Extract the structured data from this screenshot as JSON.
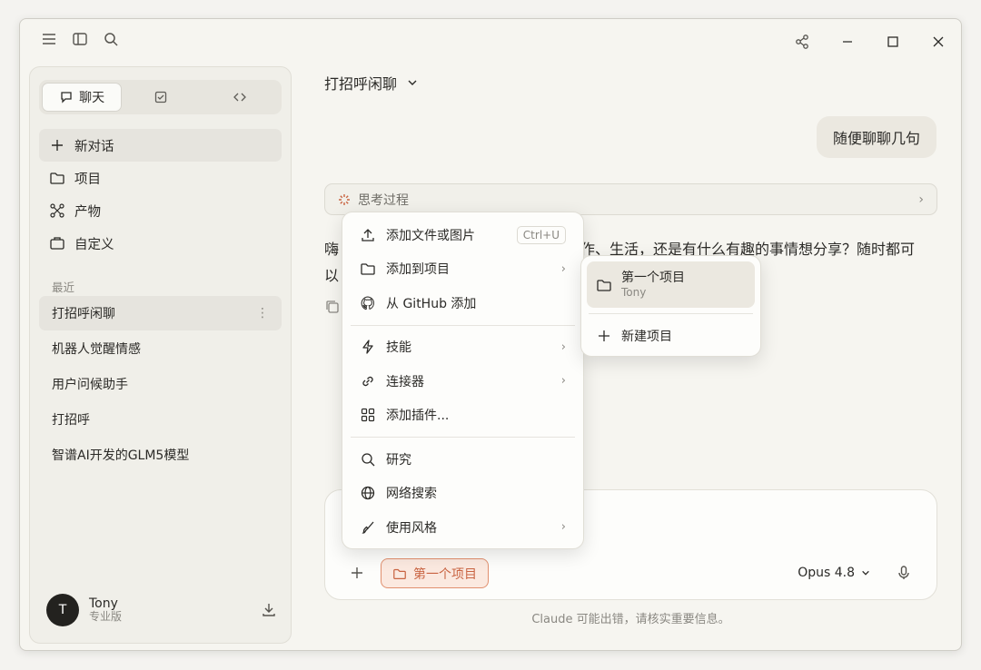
{
  "sidebar": {
    "tabs": [
      {
        "label": "聊天",
        "icon": "chat-bubble-icon"
      },
      {
        "label": "",
        "icon": "checkbox-icon"
      },
      {
        "label": "",
        "icon": "code-icon"
      }
    ],
    "nav": [
      {
        "label": "新对话",
        "icon": "plus-icon"
      },
      {
        "label": "项目",
        "icon": "folder-icon"
      },
      {
        "label": "产物",
        "icon": "artifacts-icon"
      },
      {
        "label": "自定义",
        "icon": "briefcase-icon"
      }
    ],
    "recent_label": "最近",
    "recents": [
      "打招呼闲聊",
      "机器人觉醒情感",
      "用户问候助手",
      "打招呼",
      "智谱AI开发的GLM5模型"
    ],
    "user": {
      "initial": "T",
      "name": "Tony",
      "plan": "专业版"
    }
  },
  "main": {
    "title": "打招呼闲聊",
    "user_message": "随便聊聊几句",
    "thinking_label": "思考过程",
    "reply_prefix": "嗨",
    "reply_visible": "工作、生活，还是有什么有趣的事情想分享？随时都可",
    "reply_line2_prefix": "以"
  },
  "menu": {
    "items": [
      {
        "label": "添加文件或图片",
        "icon": "upload-icon",
        "shortcut": "Ctrl+U"
      },
      {
        "label": "添加到项目",
        "icon": "folder-icon",
        "submenu": true
      },
      {
        "label": "从 GitHub 添加",
        "icon": "github-icon"
      },
      {
        "label": "技能",
        "icon": "lightning-icon",
        "submenu": true
      },
      {
        "label": "连接器",
        "icon": "link-icon",
        "submenu": true
      },
      {
        "label": "添加插件...",
        "icon": "grid-icon"
      },
      {
        "label": "研究",
        "icon": "search-icon"
      },
      {
        "label": "网络搜索",
        "icon": "globe-icon"
      },
      {
        "label": "使用风格",
        "icon": "brush-icon",
        "submenu": true
      }
    ]
  },
  "submenu": {
    "project_title": "第一个项目",
    "project_owner": "Tony",
    "new_project": "新建项目"
  },
  "composer": {
    "project_chip": "第一个项目",
    "model": "Opus 4.8"
  },
  "disclaimer": "Claude 可能出错，请核实重要信息。",
  "colors": {
    "accent": "#c96442",
    "accent_bg": "#fbe9e0",
    "window_bg": "#f6f5f0"
  }
}
